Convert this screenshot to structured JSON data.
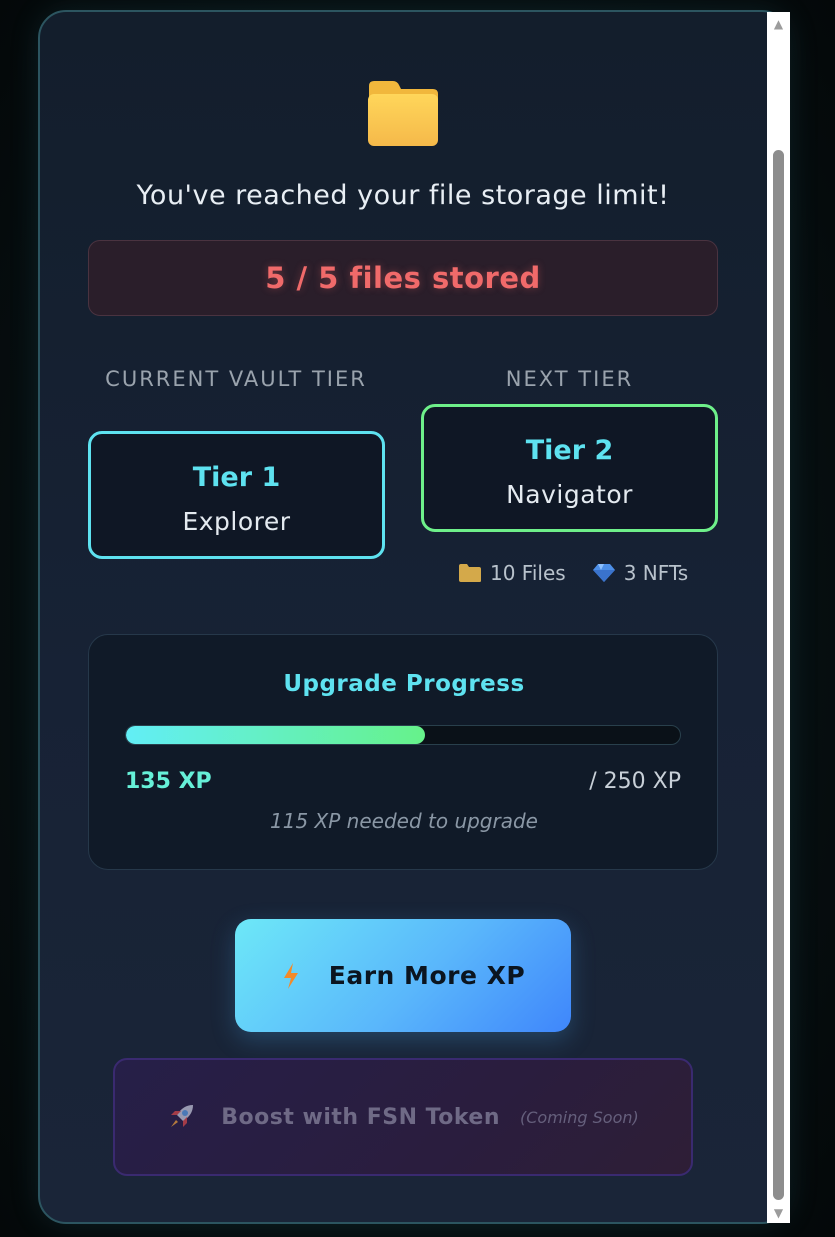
{
  "dialog": {
    "title": "You've reached your file storage limit!",
    "storage_status": "5 / 5 files stored"
  },
  "tiers": {
    "current_label": "CURRENT VAULT TIER",
    "next_label": "NEXT TIER",
    "current": {
      "tier": "Tier 1",
      "name": "Explorer",
      "border_color": "#5ee2f0"
    },
    "next": {
      "tier": "Tier 2",
      "name": "Navigator",
      "border_color": "#6ef08a"
    },
    "perks": [
      {
        "icon": "folder-icon",
        "label": "10 Files"
      },
      {
        "icon": "diamond-icon",
        "label": "3 NFTs"
      }
    ]
  },
  "progress": {
    "title": "Upgrade Progress",
    "current_xp": "135 XP",
    "target_xp": "/ 250 XP",
    "needed_text": "115 XP needed to upgrade",
    "fraction": 0.54
  },
  "actions": {
    "earn_label": "Earn More XP",
    "earn_icon": "lightning-icon",
    "boost_label": "Boost with FSN Token",
    "boost_note": "(Coming Soon)",
    "boost_icon": "rocket-icon"
  },
  "colors": {
    "accent_cyan": "#5ee2f0",
    "accent_green": "#6ef08a",
    "limit_red": "#f06a6a"
  }
}
